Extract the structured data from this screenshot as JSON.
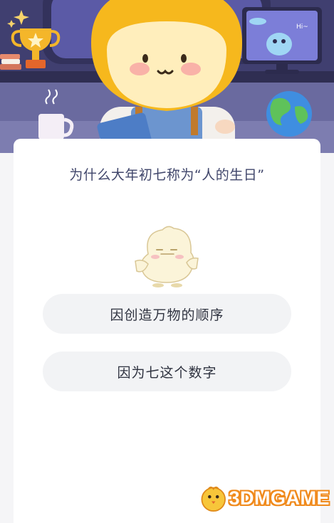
{
  "quiz": {
    "question": "为什么大年初七称为“人的生日”",
    "options": [
      {
        "label": "因创造万物的顺序"
      },
      {
        "label": "因为七这个数字"
      }
    ]
  },
  "header": {
    "monitor_greeting": "Hi~"
  },
  "watermark": {
    "text": "3DMGAME"
  },
  "colors": {
    "header_bg": "#4b4a7e",
    "card_bg": "#ffffff",
    "option_bg": "#f2f3f5",
    "question_text": "#40466b",
    "watermark_outline": "#f08a1c"
  }
}
